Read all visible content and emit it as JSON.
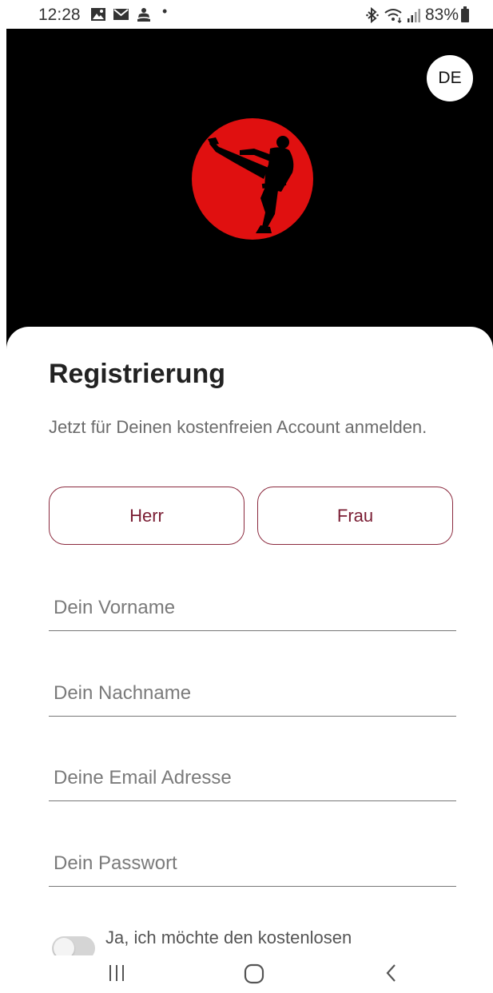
{
  "status_bar": {
    "time": "12:28",
    "dot": "•",
    "battery": "83%",
    "icons": [
      "gallery-icon",
      "mail-icon",
      "cloud-icon",
      "bluetooth-icon",
      "wifi-icon",
      "signal-icon",
      "battery-icon"
    ]
  },
  "header": {
    "language": "DE",
    "logo": "karate-kick-logo"
  },
  "form": {
    "title": "Registrierung",
    "subtitle": "Jetzt für Deinen kostenfreien Account anmelden.",
    "gender_male": "Herr",
    "gender_female": "Frau",
    "first_name_placeholder": "Dein Vorname",
    "last_name_placeholder": "Dein Nachname",
    "email_placeholder": "Deine Email Adresse",
    "password_placeholder": "Dein Passwort",
    "consent_text": "Ja, ich möchte den kostenlosen"
  },
  "nav": {
    "icons": [
      "recent-apps-icon",
      "home-icon",
      "back-icon"
    ]
  },
  "colors": {
    "accent": "#8b2a3e",
    "logo_red": "#e01010",
    "hero_bg": "#000000"
  }
}
